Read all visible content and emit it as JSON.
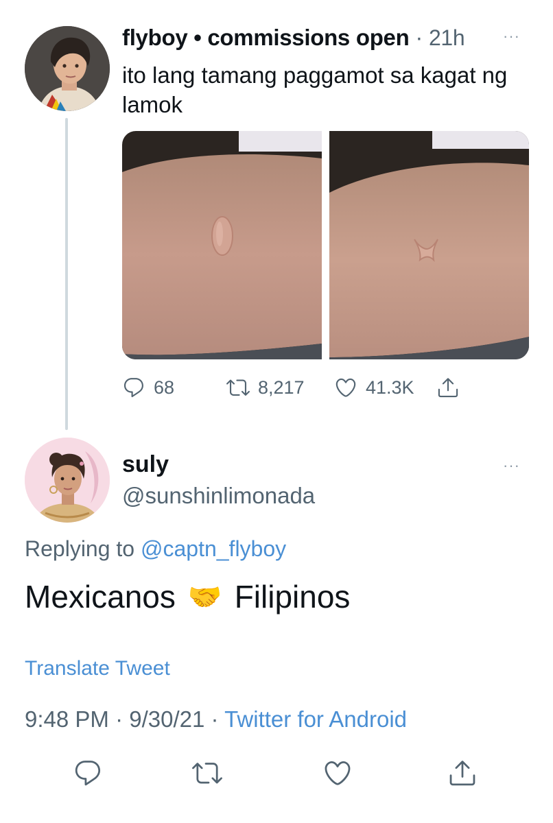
{
  "parent_tweet": {
    "display_name": "flyboy • commissions open",
    "separator": "·",
    "time": "21h",
    "more": "···",
    "text": "ito lang tamang paggamot sa kagat ng lamok",
    "actions": {
      "replies": "68",
      "retweets": "8,217",
      "likes": "41.3K"
    }
  },
  "reply_tweet": {
    "display_name": "suly",
    "handle": "@sunshinlimonada",
    "more": "···",
    "replying_prefix": "Replying to",
    "replying_mention": "@captn_flyboy",
    "text_before": "Mexicanos",
    "emoji": "🤝",
    "text_after": "Filipinos",
    "translate": "Translate Tweet",
    "timestamp": "9:48 PM · 9/30/21 · ",
    "source": "Twitter for Android"
  },
  "icons": {
    "reply": "reply-icon",
    "retweet": "retweet-icon",
    "like": "heart-icon",
    "share": "share-icon"
  },
  "colors": {
    "link": "#4a8fd4",
    "secondary_text": "#536471",
    "thread_line": "#cfd9de"
  }
}
